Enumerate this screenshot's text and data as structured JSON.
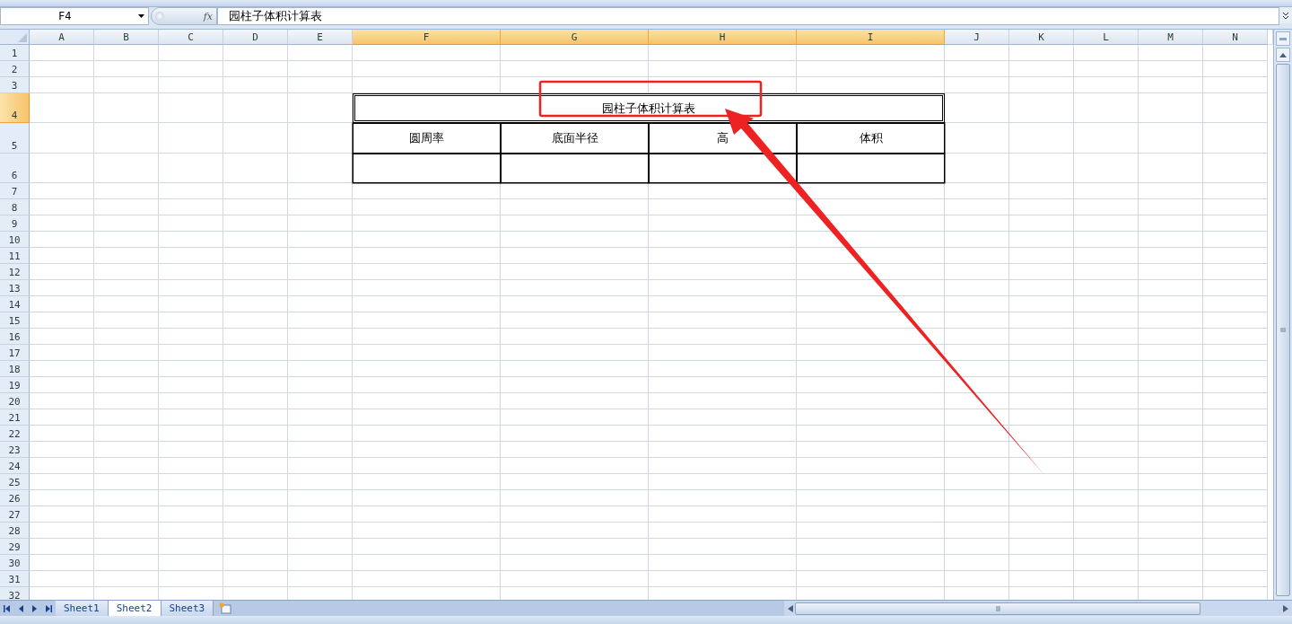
{
  "formula_bar": {
    "name_box": "F4",
    "fx_label": "fx",
    "formula": "园柱子体积计算表"
  },
  "columns": [
    {
      "label": "A",
      "selected": false
    },
    {
      "label": "B",
      "selected": false
    },
    {
      "label": "C",
      "selected": false
    },
    {
      "label": "D",
      "selected": false
    },
    {
      "label": "E",
      "selected": false
    },
    {
      "label": "F",
      "selected": true
    },
    {
      "label": "G",
      "selected": true
    },
    {
      "label": "H",
      "selected": true
    },
    {
      "label": "I",
      "selected": true
    },
    {
      "label": "J",
      "selected": false
    },
    {
      "label": "K",
      "selected": false
    },
    {
      "label": "L",
      "selected": false
    },
    {
      "label": "M",
      "selected": false
    },
    {
      "label": "N",
      "selected": false
    }
  ],
  "rows": [
    {
      "label": "1",
      "selected": false
    },
    {
      "label": "2",
      "selected": false
    },
    {
      "label": "3",
      "selected": false
    },
    {
      "label": "4",
      "selected": true
    },
    {
      "label": "5",
      "selected": false
    },
    {
      "label": "6",
      "selected": false
    },
    {
      "label": "7",
      "selected": false
    },
    {
      "label": "8",
      "selected": false
    },
    {
      "label": "9",
      "selected": false
    },
    {
      "label": "10",
      "selected": false
    },
    {
      "label": "11",
      "selected": false
    },
    {
      "label": "12",
      "selected": false
    },
    {
      "label": "13",
      "selected": false
    },
    {
      "label": "14",
      "selected": false
    },
    {
      "label": "15",
      "selected": false
    },
    {
      "label": "16",
      "selected": false
    },
    {
      "label": "17",
      "selected": false
    },
    {
      "label": "18",
      "selected": false
    },
    {
      "label": "19",
      "selected": false
    },
    {
      "label": "20",
      "selected": false
    },
    {
      "label": "21",
      "selected": false
    },
    {
      "label": "22",
      "selected": false
    },
    {
      "label": "23",
      "selected": false
    },
    {
      "label": "24",
      "selected": false
    },
    {
      "label": "25",
      "selected": false
    },
    {
      "label": "26",
      "selected": false
    },
    {
      "label": "27",
      "selected": false
    },
    {
      "label": "28",
      "selected": false
    },
    {
      "label": "29",
      "selected": false
    },
    {
      "label": "30",
      "selected": false
    },
    {
      "label": "31",
      "selected": false
    },
    {
      "label": "32",
      "selected": false
    }
  ],
  "table": {
    "title": "园柱子体积计算表",
    "headers": [
      "圆周率",
      "底面半径",
      "高",
      "体积"
    ]
  },
  "sheets": [
    {
      "label": "Sheet1",
      "selected": false
    },
    {
      "label": "Sheet2",
      "selected": true
    },
    {
      "label": "Sheet3",
      "selected": false
    }
  ]
}
